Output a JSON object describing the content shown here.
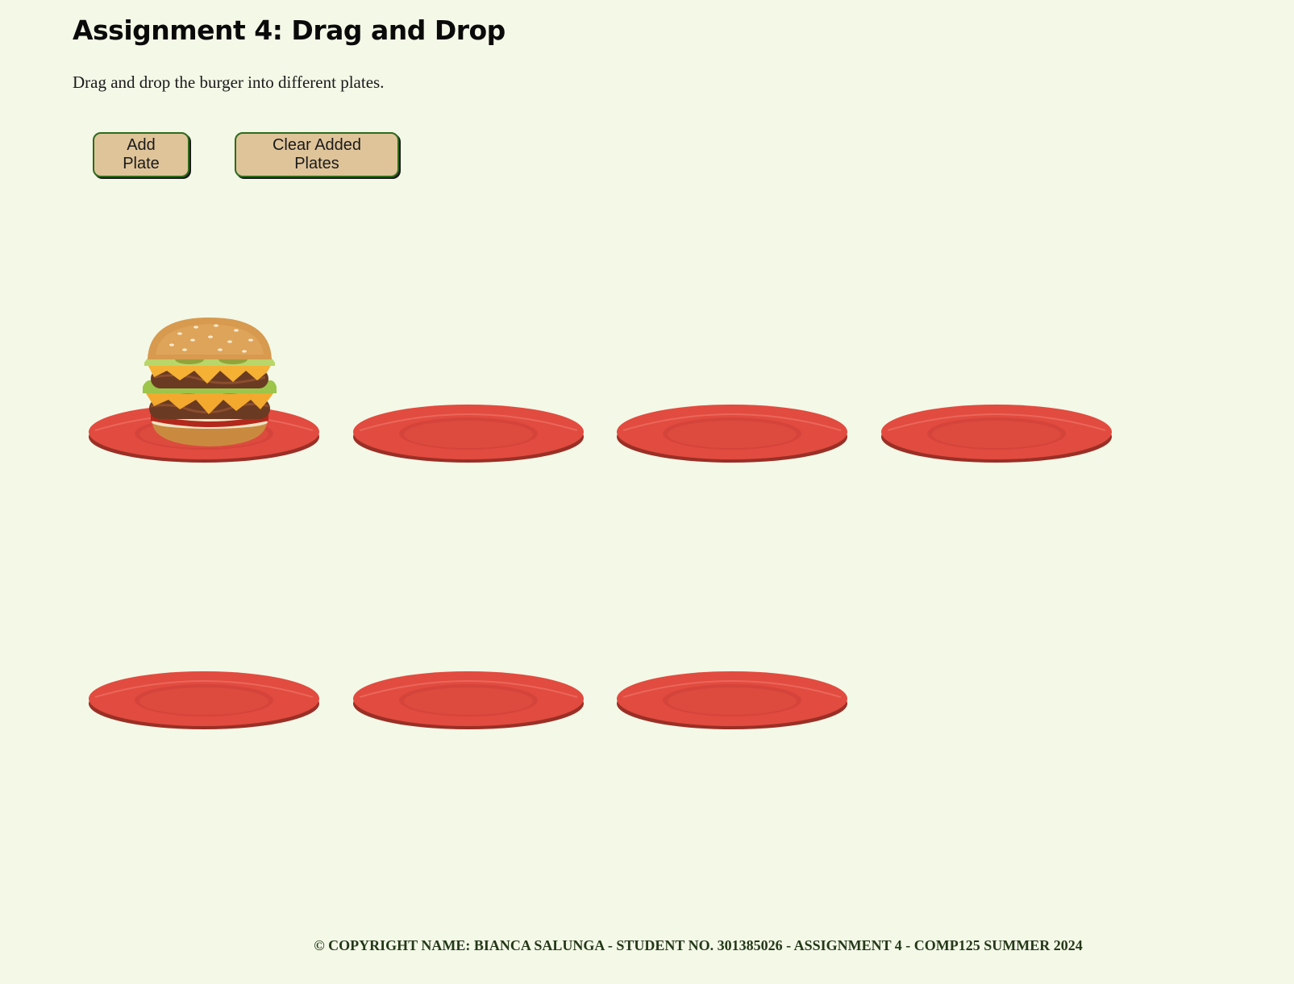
{
  "header": {
    "title": "Assignment 4: Drag and Drop",
    "subtitle": "Drag and drop the burger into different plates."
  },
  "toolbar": {
    "add_label": "Add Plate",
    "clear_label": "Clear Added Plates"
  },
  "plates": {
    "count": 7,
    "burger_on_plate": 1,
    "color": "#e24b3f"
  },
  "footer": {
    "text": "© COPYRIGHT  NAME: BIANCA SALUNGA - STUDENT NO. 301385026 - ASSIGNMENT 4 - COMP125 SUMMER 2024"
  },
  "colors": {
    "background": "#f3f8e7",
    "button_fill": "#dfc49a",
    "button_border": "#2f6b1c",
    "plate": "#e24b3f"
  },
  "icons": {
    "burger": "burger-icon",
    "plate": "plate-icon"
  }
}
